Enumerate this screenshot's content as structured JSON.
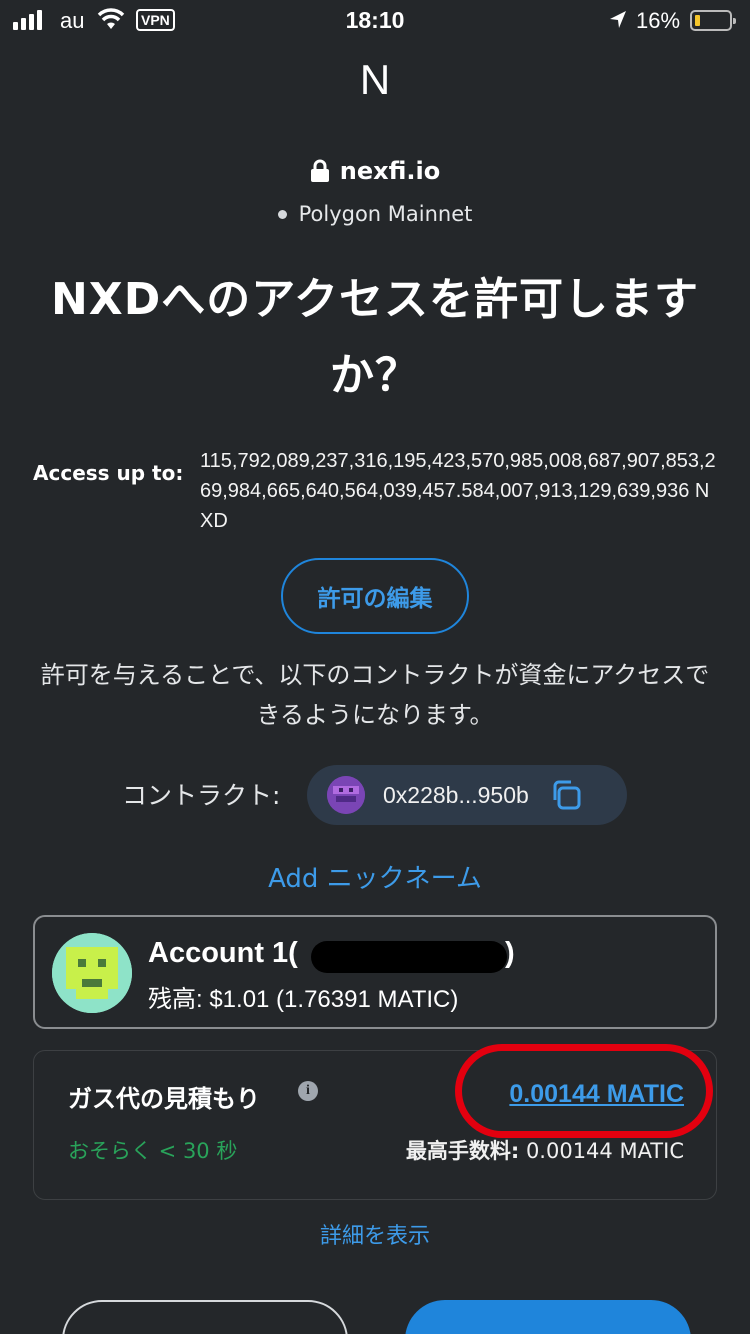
{
  "status_bar": {
    "carrier": "au",
    "vpn": "VPN",
    "time": "18:10",
    "battery_percent": "16%",
    "battery_level": 0.16,
    "battery_color": "#f5c62b"
  },
  "site": {
    "initial": "N",
    "domain": "nexfi.io",
    "network": "Polygon Mainnet"
  },
  "title": "NXDへのアクセスを許可しますか？",
  "access": {
    "label": "Access up to:",
    "value": "115,792,089,237,316,195,423,570,985,008,687,907,853,269,984,665,640,564,039,457.584,007,913,129,639,936 NXD"
  },
  "edit_permission_label": "許可の編集",
  "description": "許可を与えることで、以下のコントラクトが資金にアクセスできるようになります。",
  "contract": {
    "label": "コントラクト:",
    "address": "0x228b...950b"
  },
  "add_nickname_label": "Add ニックネーム",
  "account": {
    "name": "Account 1(",
    "name_suffix": ")",
    "balance": "残高: $1.01 (1.76391 MATIC)"
  },
  "gas": {
    "label": "ガス代の見積もり",
    "info_glyph": "i",
    "amount": "0.00144 MATIC",
    "time": "おそらく < 30 秒",
    "max_fee_label": "最高手数料:",
    "max_fee_value": " 0.00144 MATIC",
    "highlight_color": "#e3000f"
  },
  "show_details_label": "詳細を表示",
  "colors": {
    "background": "#24272a",
    "accent": "#1f85db",
    "link": "#3d9be9",
    "success": "#29a35a"
  }
}
